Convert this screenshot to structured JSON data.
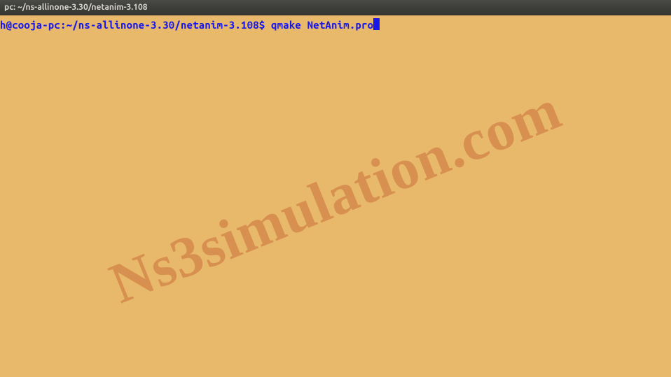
{
  "window": {
    "title": "pc: ~/ns-allinone-3.30/netanim-3.108"
  },
  "terminal": {
    "prompt": "h@cooja-pc:~/ns-allinone-3.30/netanim-3.108$ ",
    "command": "qmake NetAnim.pro"
  },
  "watermark": {
    "text": "Ns3simulation.com"
  }
}
